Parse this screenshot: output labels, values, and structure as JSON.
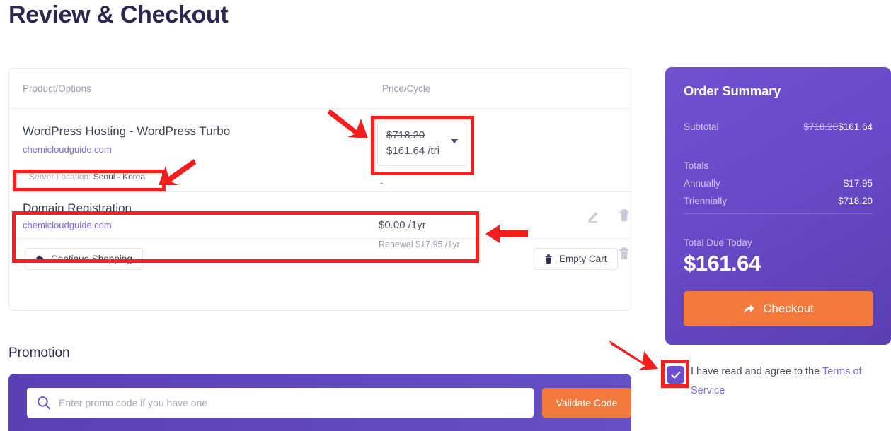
{
  "page": {
    "title": "Review & Checkout"
  },
  "cart": {
    "columns": {
      "product": "Product/Options",
      "price": "Price/Cycle"
    },
    "items": [
      {
        "name": "WordPress Hosting - WordPress Turbo",
        "domain": "chemicloudguide.com",
        "option_label": "Server Location:",
        "option_value": "Seoul - Korea",
        "price_old": "$718.20",
        "price_new": "$161.64 /tri",
        "dash": "-",
        "edit_icon": "pencil-icon",
        "delete_icon": "trash-icon"
      },
      {
        "name": "Domain Registration",
        "domain": "chemicloudguide.com",
        "price": "$0.00 /1yr",
        "renewal": "Renewal $17.95 /1yr",
        "edit_icon": "pencil-icon",
        "delete_icon": "trash-icon"
      }
    ],
    "continue_shopping": "Continue Shopping",
    "empty_cart": "Empty Cart"
  },
  "summary": {
    "title": "Order Summary",
    "subtotal_label": "Subtotal",
    "subtotal_old": "$718.20",
    "subtotal_new": "$161.64",
    "totals_label": "Totals",
    "annually_label": "Annually",
    "annually_value": "$17.95",
    "triennially_label": "Triennially",
    "triennially_value": "$718.20",
    "total_due_label": "Total Due Today",
    "total_due_value": "$161.64",
    "checkout_label": "Checkout"
  },
  "terms": {
    "prefix": "I have read and agree to the ",
    "link": "Terms of Service",
    "checked": true
  },
  "promotion": {
    "heading": "Promotion",
    "placeholder": "Enter promo code if you have one",
    "value": "",
    "validate_label": "Validate Code"
  },
  "colors": {
    "brand_purple": "#6a4ac9",
    "deep_purple": "#5a3fb2",
    "accent_orange": "#f4793c",
    "title_navy": "#2d2650",
    "link_violet": "#7b6ce0",
    "annotation_red": "#fa1f1f"
  }
}
